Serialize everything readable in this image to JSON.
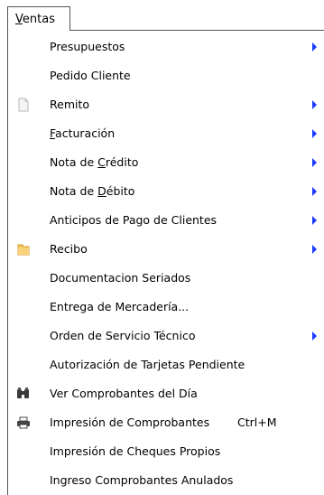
{
  "menubar": {
    "tab_first_letter": "V",
    "tab_rest": "entas"
  },
  "menu": {
    "items": [
      {
        "label": "Presupuestos",
        "submenu": true
      },
      {
        "label": "Pedido Cliente",
        "submenu": false
      },
      {
        "label": "Remito",
        "submenu": true,
        "icon": "document-icon"
      },
      {
        "label_u": "F",
        "label_rest": "acturación",
        "submenu": true
      },
      {
        "label_pre": "Nota de ",
        "label_u": "C",
        "label_rest": "rédito",
        "submenu": true
      },
      {
        "label_pre": "Nota de ",
        "label_u": "D",
        "label_rest": "ébito",
        "submenu": true
      },
      {
        "label": "Anticipos de Pago de Clientes",
        "submenu": true
      },
      {
        "label": "Recibo",
        "submenu": true,
        "icon": "folder-icon"
      },
      {
        "label": "Documentacion Seriados",
        "submenu": false
      },
      {
        "label": "Entrega de Mercadería...",
        "submenu": false
      },
      {
        "label": "Orden de Servicio Técnico",
        "submenu": true
      },
      {
        "label": "Autorización de Tarjetas Pendiente",
        "submenu": false
      },
      {
        "label": "Ver Comprobantes del Día",
        "submenu": false,
        "icon": "binoculars-icon"
      },
      {
        "label": "Impresión de Comprobantes",
        "shortcut": "Ctrl+M",
        "submenu": false,
        "icon": "printer-icon"
      },
      {
        "label": "Impresión de Cheques Propios",
        "submenu": false
      },
      {
        "label": "Ingreso Comprobantes Anulados",
        "submenu": false
      }
    ]
  },
  "colors": {
    "submenu_arrow": "#1a3bff",
    "border": "#555555"
  }
}
